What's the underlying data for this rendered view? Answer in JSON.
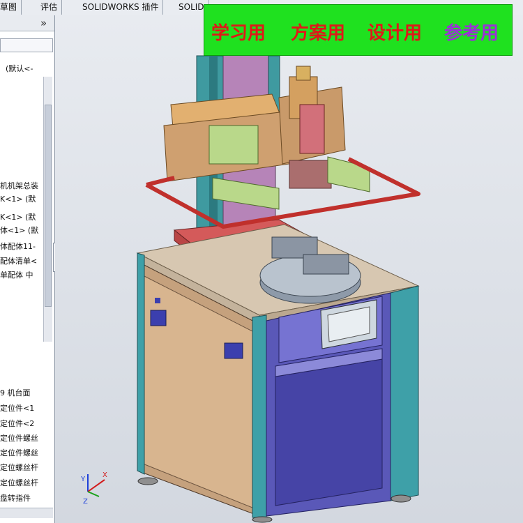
{
  "tabs": [
    "草图",
    "评估",
    "SOLIDWORKS 插件",
    "SOLID"
  ],
  "tree": {
    "collapse_icon": "»",
    "items": [
      "(默认<-",
      "机机架总装",
      "K<1> (默",
      "K<1> (默",
      "体<1> (默",
      "体配体11-",
      "配体清单<",
      "单配体 中",
      "9 机台面",
      "定位件<1",
      "定位件<2",
      "定位件螺丝",
      "定位件螺丝",
      "定位螺丝杆",
      "定位螺丝杆",
      "盘转指件"
    ]
  },
  "banner": {
    "texts": [
      "学习用",
      "方案用",
      "设计用",
      "参考用"
    ],
    "colors": [
      "#e01818",
      "#e01818",
      "#e01818",
      "#9b30d8"
    ],
    "background": "#1fe11f"
  },
  "triad": {
    "x": "X",
    "y": "Y",
    "z": "Z"
  }
}
